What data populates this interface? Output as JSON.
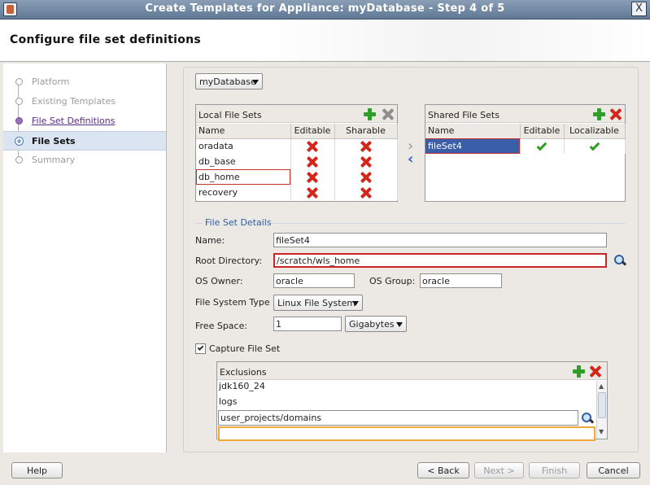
{
  "window": {
    "title": "Create Templates for Appliance: myDatabase - Step 4 of 5",
    "close_label": "X"
  },
  "header": {
    "title": "Configure file set definitions"
  },
  "nav": {
    "items": [
      {
        "label": "Platform",
        "state": "future"
      },
      {
        "label": "Existing Templates",
        "state": "future"
      },
      {
        "label": "File Set Definitions",
        "state": "visited"
      },
      {
        "label": "File Sets",
        "state": "current"
      },
      {
        "label": "Summary",
        "state": "future"
      }
    ]
  },
  "main": {
    "appliance_select": "myDatabase",
    "local_file_sets": {
      "title": "Local File Sets",
      "columns": [
        "Name",
        "Editable",
        "Sharable"
      ],
      "rows": [
        {
          "name": "oradata",
          "editable": false,
          "sharable": false
        },
        {
          "name": "db_base",
          "editable": false,
          "sharable": false
        },
        {
          "name": "db_home",
          "editable": false,
          "sharable": false
        },
        {
          "name": "recovery",
          "editable": false,
          "sharable": false
        }
      ]
    },
    "shared_file_sets": {
      "title": "Shared File Sets",
      "columns": [
        "Name",
        "Editable",
        "Localizable"
      ],
      "rows": [
        {
          "name": "fileSet4",
          "editable": true,
          "localizable": true
        }
      ]
    },
    "details": {
      "section_title": "File Set Details",
      "name_label": "Name:",
      "name_value": "fileSet4",
      "root_dir_label": "Root Directory:",
      "root_dir_value": "/scratch/wls_home",
      "os_owner_label": "OS Owner:",
      "os_owner_value": "oracle",
      "os_group_label": "OS Group:",
      "os_group_value": "oracle",
      "fs_type_label": "File System Type",
      "fs_type_value": "Linux File System",
      "free_space_label": "Free Space:",
      "free_space_value": "1",
      "free_space_unit": "Gigabytes",
      "capture_label": "Capture File Set",
      "capture_checked": true
    },
    "exclusions": {
      "title": "Exclusions",
      "items": [
        "jdk160_24",
        "logs",
        "user_projects/domains",
        ""
      ]
    }
  },
  "footer": {
    "help": "Help",
    "back": "< Back",
    "next": "Next >",
    "finish": "Finish",
    "cancel": "Cancel"
  }
}
